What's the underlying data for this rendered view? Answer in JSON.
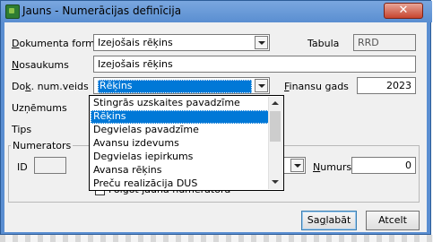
{
  "window": {
    "title": "Jauns - Numerācijas definīcija",
    "close_label": "✕"
  },
  "form": {
    "dokumenta_forma": {
      "label_pre": "D",
      "label_post": "okumenta forma",
      "value": "Izejošais rēķins"
    },
    "tabula": {
      "label": "Tabula",
      "value": "RRD"
    },
    "nosaukums": {
      "label_pre": "N",
      "label_post": "osaukums",
      "value": "Izejošais rēķins"
    },
    "dok_num_veids": {
      "label_pre": "Do",
      "label_u": "k",
      "label_post": ". num.veids",
      "value": "Rēķins"
    },
    "finansu_gads": {
      "label_pre": "F",
      "label_post": "inansu gads",
      "value": "2023"
    },
    "uznemums": {
      "label": "Uzņēmums"
    },
    "tips": {
      "label": "Tips"
    }
  },
  "numerators": {
    "title": "Numerators",
    "id_label": "ID",
    "id_value": "",
    "numurs_label_pre": "N",
    "numurs_label_post": "umurs",
    "numurs_value": "0",
    "checkbox_label": "Folgot jauna numeratora"
  },
  "dropdown": {
    "items": [
      "Stingrās uzskaites pavadzīme",
      "Rēķins",
      "Degvielas pavadzīme",
      "Avansu izdevums",
      "Degvielas iepirkums",
      "Avansa rēķins",
      "Preču realizācija DUS"
    ],
    "selected_index": 1
  },
  "buttons": {
    "save_label_pre": "Sa",
    "save_label_u": "g",
    "save_label_post": "labāt",
    "cancel_label": "Atcelt"
  },
  "colors": {
    "titlebar": "#5a8ed1",
    "selection": "#0078d7",
    "close_button": "#c7452f"
  }
}
